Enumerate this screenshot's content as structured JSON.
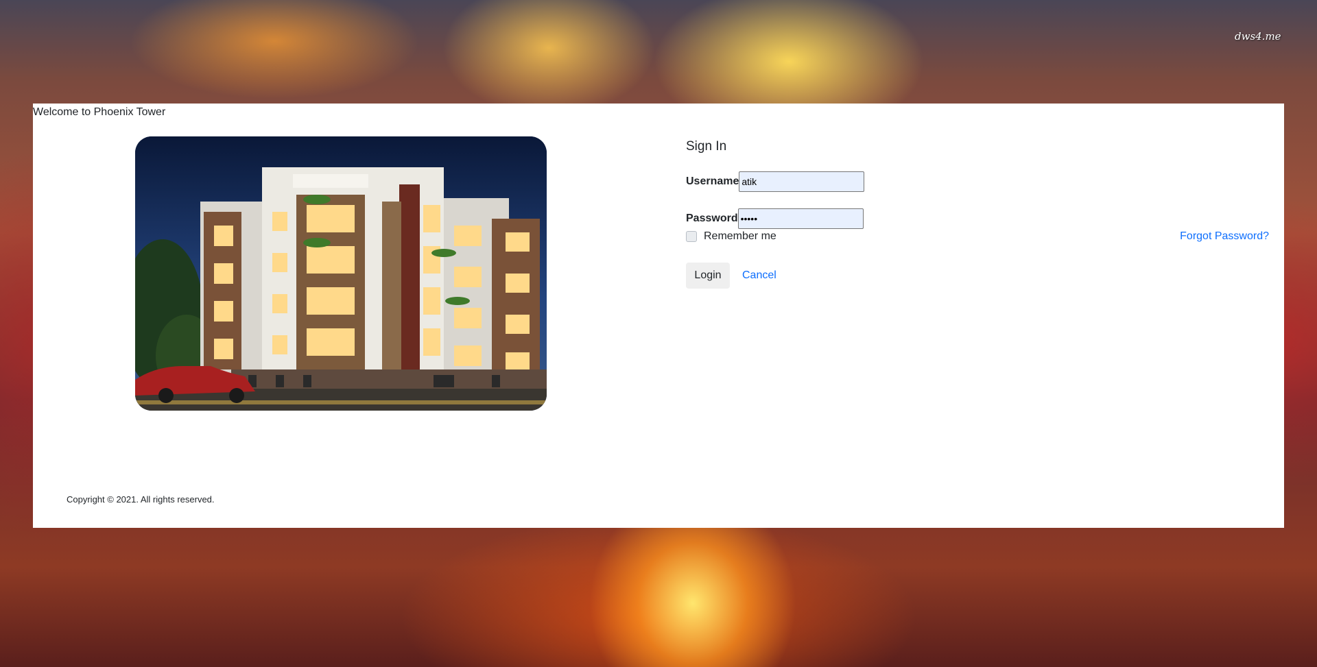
{
  "watermark": "dws4.me",
  "header": {
    "welcome": "Welcome to Phoenix Tower"
  },
  "hero_image": {
    "alt": "Phoenix Tower apartment building at night"
  },
  "form": {
    "title": "Sign In",
    "username_label": "Username",
    "username_value": "atik",
    "password_label": "Password",
    "password_value": "atik1",
    "remember_label": "Remember me",
    "remember_checked": false,
    "forgot_label": "Forgot Password?",
    "login_label": "Login",
    "cancel_label": "Cancel"
  },
  "footer": {
    "copyright": "Copyright © 2021. All rights reserved."
  },
  "colors": {
    "link": "#0d6efd",
    "autofill_bg": "#e8f0fe",
    "card_bg": "#ffffff"
  }
}
